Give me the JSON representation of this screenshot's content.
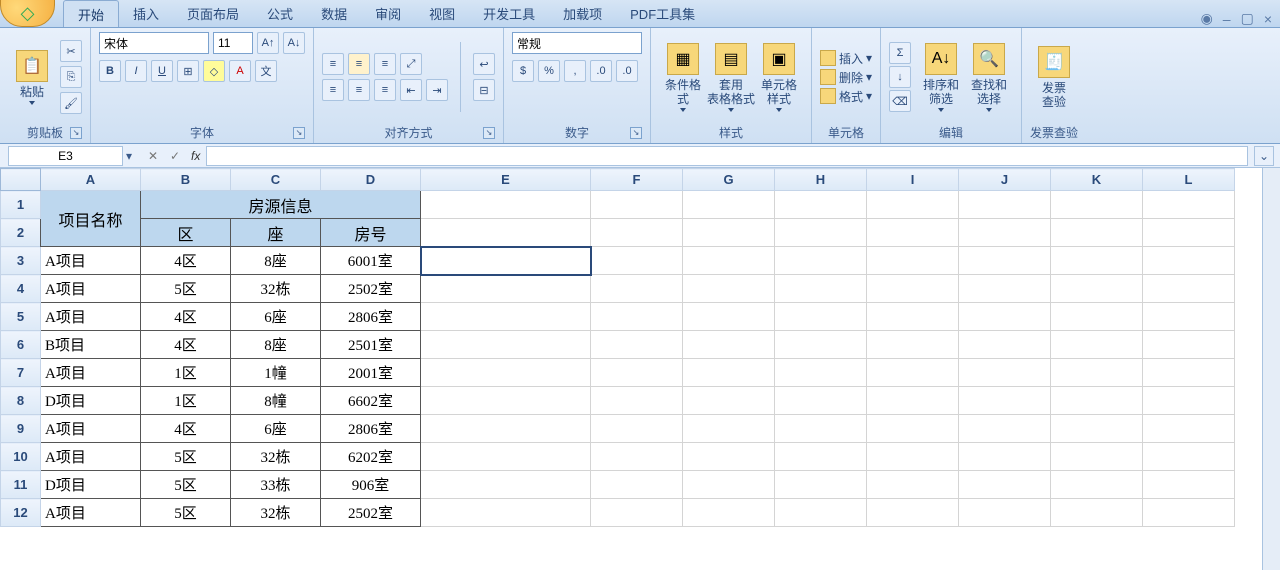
{
  "tabs": [
    "开始",
    "插入",
    "页面布局",
    "公式",
    "数据",
    "审阅",
    "视图",
    "开发工具",
    "加载项",
    "PDF工具集"
  ],
  "activeTab": 0,
  "ribbon": {
    "clipboard": {
      "paste": "粘贴",
      "label": "剪贴板"
    },
    "font": {
      "name": "宋体",
      "size": "11",
      "label": "字体"
    },
    "align": {
      "label": "对齐方式"
    },
    "number": {
      "format": "常规",
      "label": "数字"
    },
    "styles": {
      "cond": "条件格式",
      "table": "套用\n表格格式",
      "cell": "单元格\n样式",
      "label": "样式"
    },
    "cells": {
      "insert": "插入",
      "delete": "删除",
      "format": "格式",
      "label": "单元格"
    },
    "editing": {
      "sort": "排序和\n筛选",
      "find": "查找和\n选择",
      "label": "编辑"
    },
    "invoice": {
      "btn": "发票\n查验",
      "label": "发票查验"
    }
  },
  "namebox": "E3",
  "formula": "",
  "cols": [
    "A",
    "B",
    "C",
    "D",
    "E",
    "F",
    "G",
    "H",
    "I",
    "J",
    "K",
    "L"
  ],
  "headers": {
    "name": "项目名称",
    "info": "房源信息",
    "zone": "区",
    "block": "座",
    "room": "房号"
  },
  "data": [
    [
      "A项目",
      "4区",
      "8座",
      "6001室"
    ],
    [
      "A项目",
      "5区",
      "32栋",
      "2502室"
    ],
    [
      "A项目",
      "4区",
      "6座",
      "2806室"
    ],
    [
      "B项目",
      "4区",
      "8座",
      "2501室"
    ],
    [
      "A项目",
      "1区",
      "1幢",
      "2001室"
    ],
    [
      "D项目",
      "1区",
      "8幢",
      "6602室"
    ],
    [
      "A项目",
      "4区",
      "6座",
      "2806室"
    ],
    [
      "A项目",
      "5区",
      "32栋",
      "6202室"
    ],
    [
      "D项目",
      "5区",
      "33栋",
      "906室"
    ],
    [
      "A项目",
      "5区",
      "32栋",
      "2502室"
    ]
  ]
}
